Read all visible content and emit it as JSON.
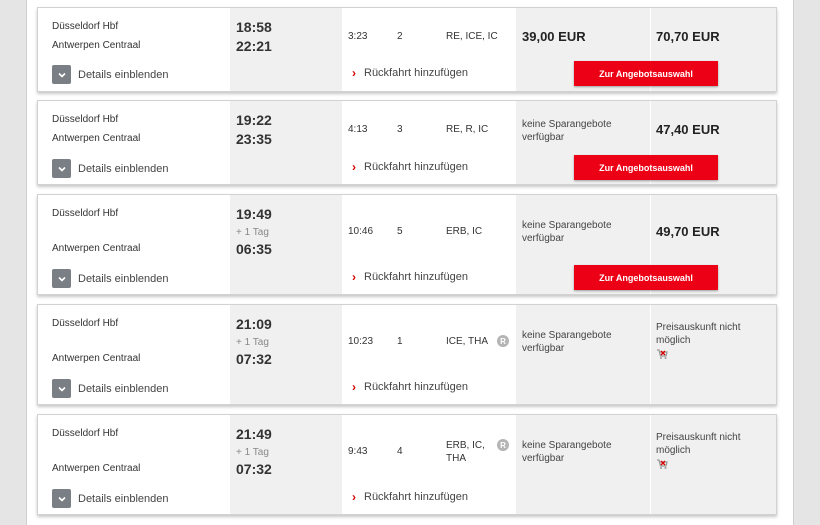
{
  "colors": {
    "accent": "#ec0016",
    "bar_bg": "#f0f0f0",
    "toggle_bg": "#7a7e85"
  },
  "connections": [
    {
      "from": "Düsseldorf Hbf",
      "to": "Antwerpen Centraal",
      "dep": "18:58",
      "arr": "22:21",
      "plus_day": "",
      "duration": "3:23",
      "changes": "2",
      "products": "RE, ICE, IC",
      "reservation": "",
      "sparpreis": "39,00 EUR",
      "flexpreis": "70,70 EUR",
      "cta": "Zur Angebotsauswahl",
      "details": "Details einblenden",
      "return": "Rückfahrt hinzufügen"
    },
    {
      "from": "Düsseldorf Hbf",
      "to": "Antwerpen Centraal",
      "dep": "19:22",
      "arr": "23:35",
      "plus_day": "",
      "duration": "4:13",
      "changes": "3",
      "products": "RE, R, IC",
      "reservation": "",
      "sparpreis": "keine Sparangebote verfügbar",
      "flexpreis": "47,40 EUR",
      "cta": "Zur Angebotsauswahl",
      "details": "Details einblenden",
      "return": "Rückfahrt hinzufügen"
    },
    {
      "from": "Düsseldorf Hbf",
      "to": "Antwerpen Centraal",
      "dep": "19:49",
      "arr": "06:35",
      "plus_day": "+ 1 Tag",
      "duration": "10:46",
      "changes": "5",
      "products": "ERB, IC",
      "reservation": "",
      "sparpreis": "keine Sparangebote verfügbar",
      "flexpreis": "49,70 EUR",
      "cta": "Zur Angebotsauswahl",
      "details": "Details einblenden",
      "return": "Rückfahrt hinzufügen"
    },
    {
      "from": "Düsseldorf Hbf",
      "to": "Antwerpen Centraal",
      "dep": "21:09",
      "arr": "07:32",
      "plus_day": "+ 1 Tag",
      "duration": "10:23",
      "changes": "1",
      "products": "ICE, THA",
      "reservation": "R",
      "sparpreis": "keine Sparangebote verfügbar",
      "flexpreis": "Preisauskunft nicht möglich",
      "cart_icon": "cart-icon",
      "details": "Details einblenden",
      "return": "Rückfahrt hinzufügen"
    },
    {
      "from": "Düsseldorf Hbf",
      "to": "Antwerpen Centraal",
      "dep": "21:49",
      "arr": "07:32",
      "plus_day": "+ 1 Tag",
      "duration": "9:43",
      "changes": "4",
      "products": "ERB, IC, THA",
      "reservation": "R",
      "sparpreis": "keine Sparangebote verfügbar",
      "flexpreis": "Preisauskunft nicht möglich",
      "cart_icon": "cart-icon",
      "details": "Details einblenden",
      "return": "Rückfahrt hinzufügen"
    }
  ]
}
